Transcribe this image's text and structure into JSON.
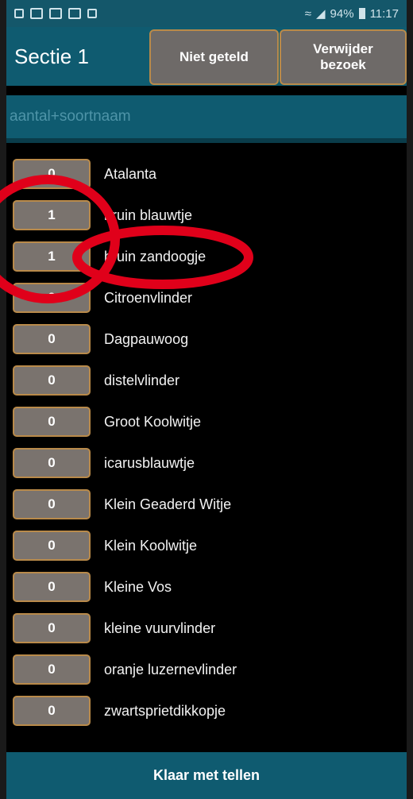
{
  "statusbar": {
    "battery": "94%",
    "time": "11:17"
  },
  "header": {
    "title": "Sectie 1",
    "btn_niet": "Niet geteld",
    "btn_verwijder": "Verwijder bezoek"
  },
  "search": {
    "placeholder": "aantal+soortnaam"
  },
  "species": [
    {
      "count": "0",
      "name": "Atalanta"
    },
    {
      "count": "1",
      "name": "bruin blauwtje"
    },
    {
      "count": "1",
      "name": "bruin zandoogje"
    },
    {
      "count": "0",
      "name": "Citroenvlinder"
    },
    {
      "count": "0",
      "name": "Dagpauwoog"
    },
    {
      "count": "0",
      "name": "distelvlinder"
    },
    {
      "count": "0",
      "name": "Groot Koolwitje"
    },
    {
      "count": "0",
      "name": "icarusblauwtje"
    },
    {
      "count": "0",
      "name": "Klein Geaderd Witje"
    },
    {
      "count": "0",
      "name": "Klein Koolwitje"
    },
    {
      "count": "0",
      "name": "Kleine Vos"
    },
    {
      "count": "0",
      "name": "kleine vuurvlinder"
    },
    {
      "count": "0",
      "name": "oranje luzernevlinder"
    },
    {
      "count": "0",
      "name": "zwartsprietdikkopje"
    }
  ],
  "footer": {
    "done_label": "Klaar met tellen"
  },
  "colors": {
    "header": "#0f5b70",
    "button": "#7a736e",
    "button_border": "#b98a4a",
    "annotation": "#e0001a"
  }
}
